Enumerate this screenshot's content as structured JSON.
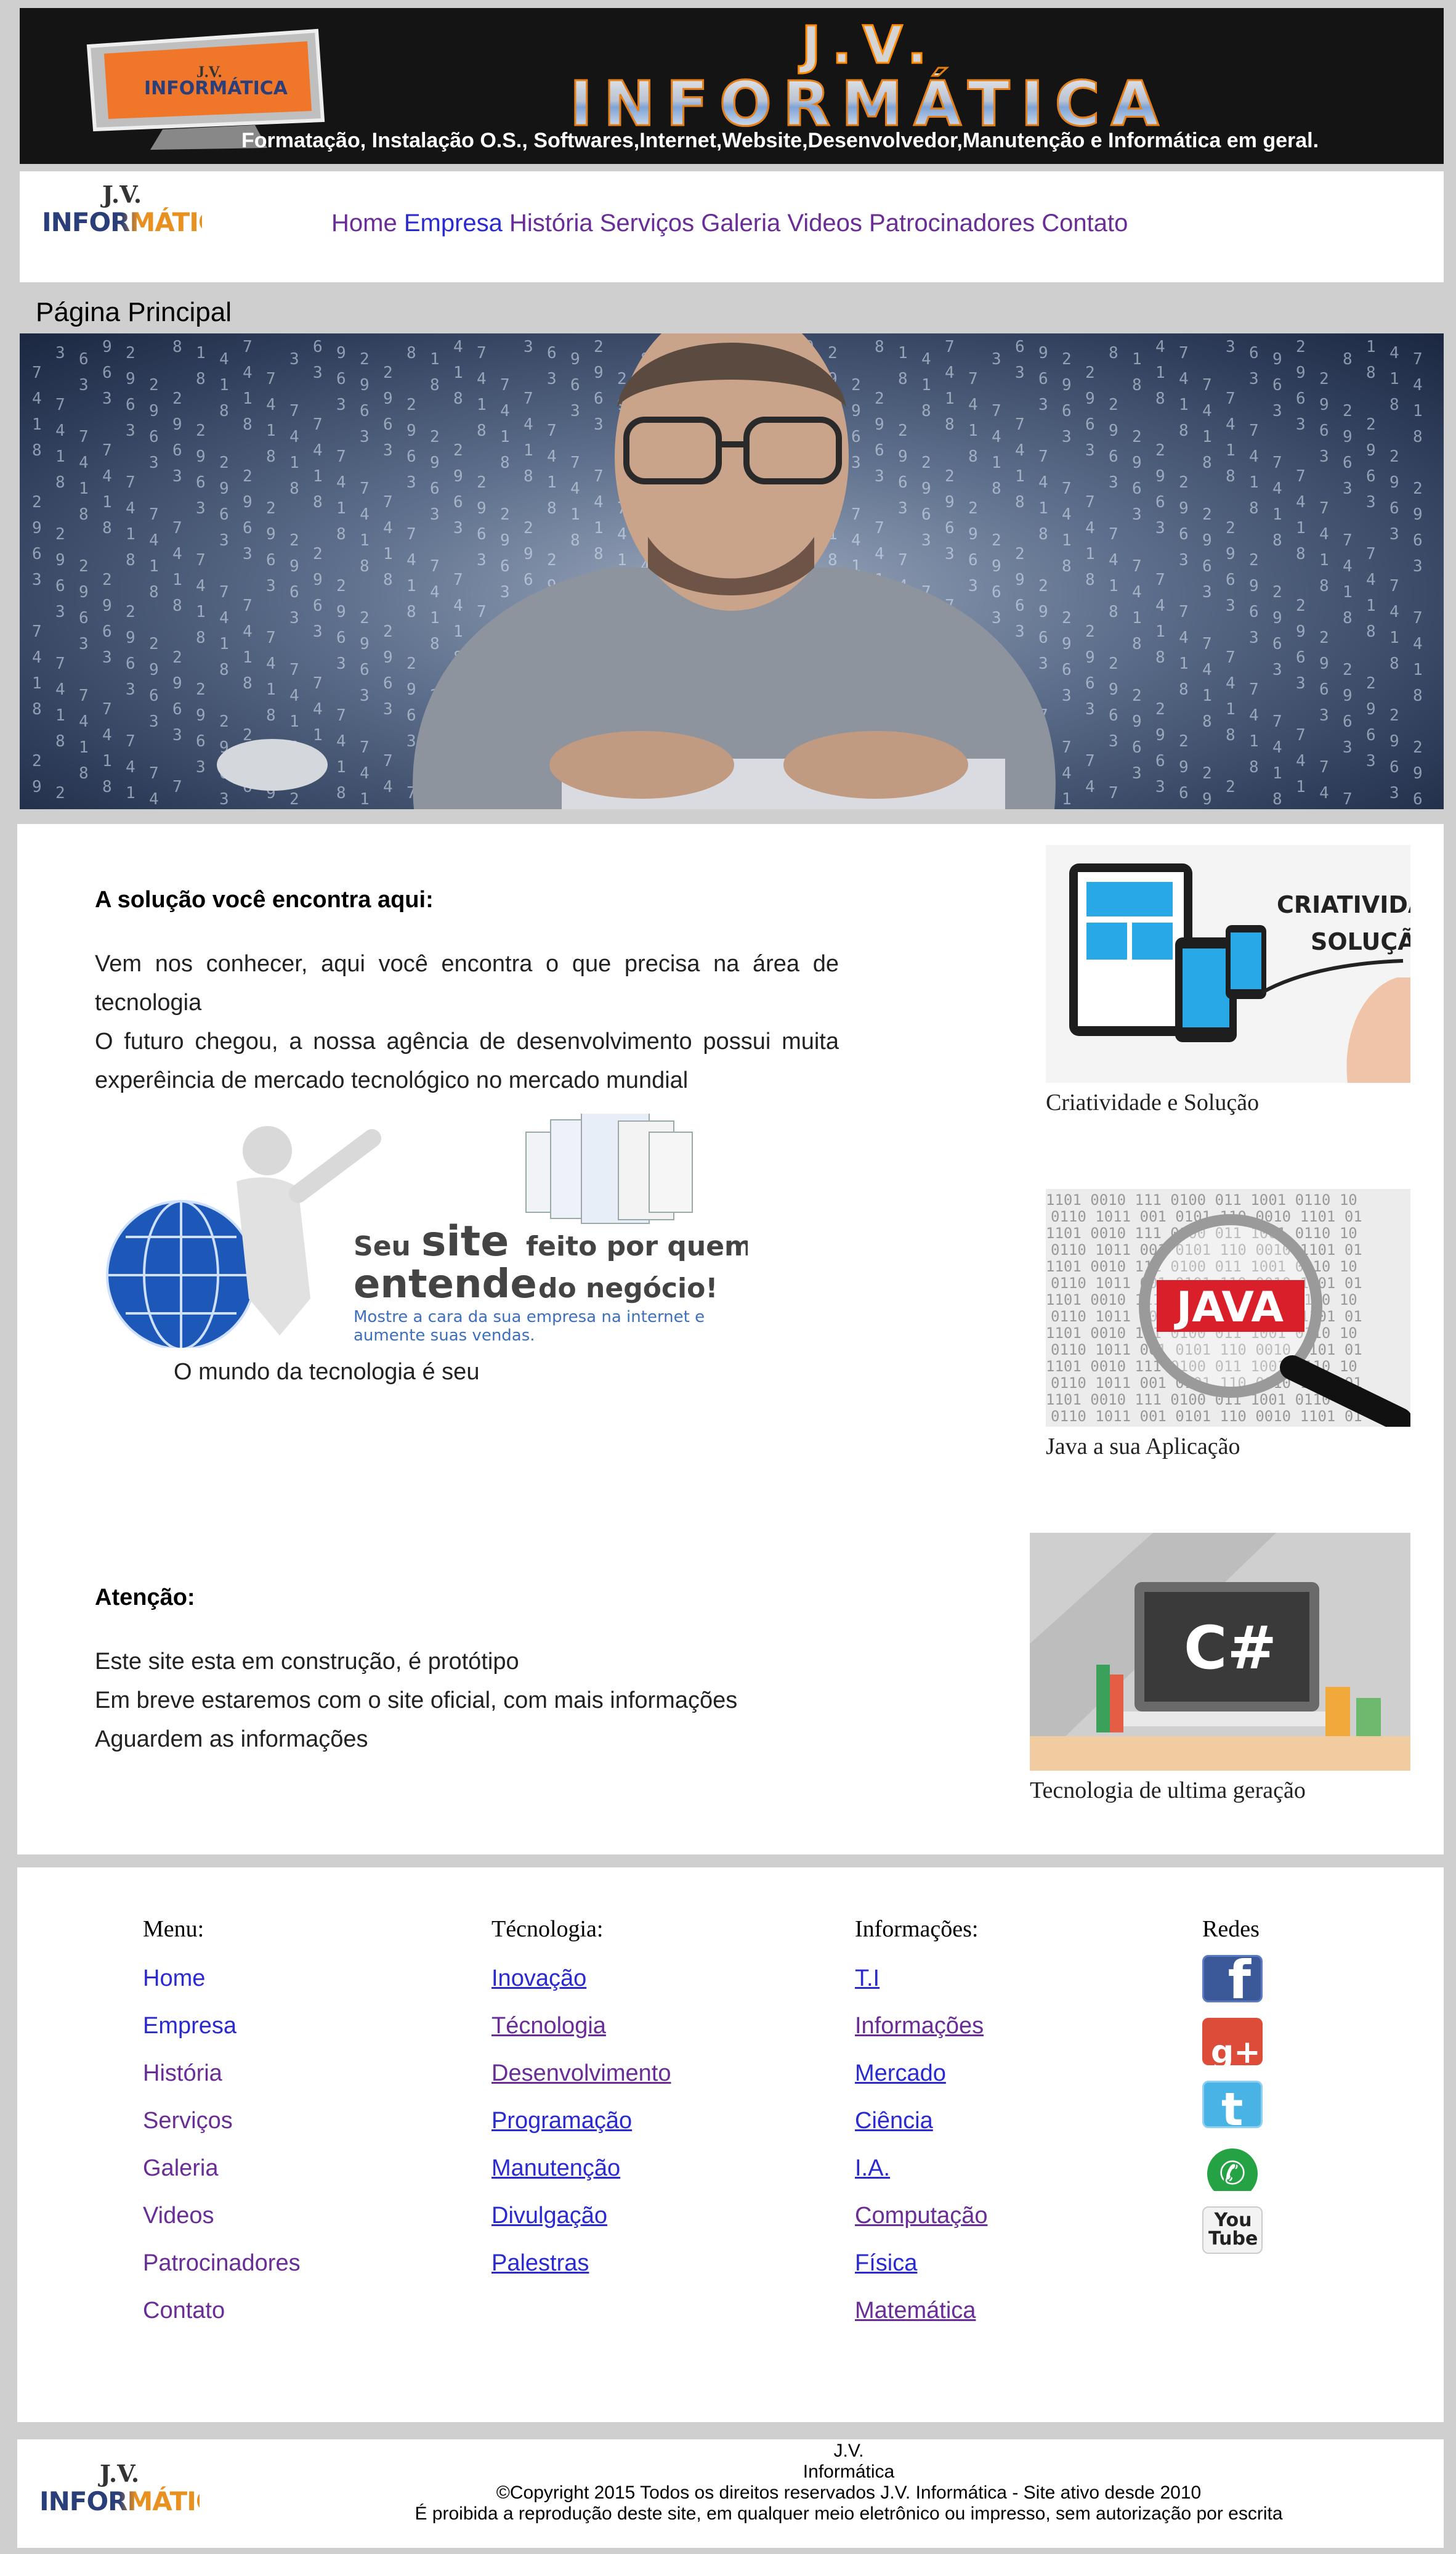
{
  "banner": {
    "brand_top": "J.V.",
    "brand_word": "INFORMÁTICA",
    "monitor_text_1": "J.V.",
    "monitor_text_2": "INFORMÁTICA",
    "tagline": "Formatação, Instalação O.S., Softwares,Internet,Website,Desenvolvedor,Manutenção e Informática em geral."
  },
  "logo": {
    "line1": "J.V.",
    "line2": "INFORMÁTICA"
  },
  "nav": {
    "items": [
      "Home",
      "Empresa",
      "História",
      "Serviços",
      "Galeria",
      "Videos",
      "Patrocinadores",
      "Contato"
    ],
    "current_color": "#2a2ad2",
    "visited_color": "#6a2c96"
  },
  "page_title": "Página Principal",
  "main": {
    "solution_heading": "A solução você encontra aqui:",
    "solution_lines": [
      "Vem nos conhecer, aqui você encontra o que precisa na área de tecnologia",
      "O futuro chegou, a nossa agência de desenvolvimento possui muita experêincia de mercado tecnológico no mercado mundial"
    ],
    "promo": {
      "line_a": "Seu",
      "line_b": "site",
      "line_c": "feito por quem",
      "line_d": "entende",
      "line_e": "do negócio!",
      "line_f": "Mostre a cara da sua empresa na internet e",
      "line_g": "aumente suas vendas."
    },
    "promo_caption": "O mundo da tecnologia é seu",
    "attention_heading": "Atenção:",
    "attention_lines": [
      "Este site esta em construção, é protótipo",
      "Em breve estaremos com o site oficial, com mais informações",
      "Aguardem as informações"
    ]
  },
  "side": [
    {
      "caption": "Criatividade e Solução",
      "img_text_1": "CRIATIVIDADE",
      "img_text_2": "SOLUÇÃO",
      "icon": "devices-icon"
    },
    {
      "caption": "Java a sua Aplicação",
      "img_text_1": "JAVA",
      "icon": "magnifier-icon"
    },
    {
      "caption": "Tecnologia de ultima geração",
      "img_text_1": "C#",
      "icon": "laptop-icon"
    }
  ],
  "footer": {
    "menu_title": "Menu:",
    "menu_items": [
      "Home",
      "Empresa",
      "História",
      "Serviços",
      "Galeria",
      "Videos",
      "Patrocinadores",
      "Contato"
    ],
    "tech_title": "Técnologia:",
    "tech_items": [
      "Inovação",
      "Técnologia",
      "Desenvolvimento",
      "Programação",
      "Manutenção",
      "Divulgação",
      "Palestras"
    ],
    "info_title": "Informações:",
    "info_items": [
      "T.I",
      "Informações",
      "Mercado",
      "Ciência",
      "I.A.",
      "Computação",
      "Física",
      "Matemática"
    ],
    "social_title": "Redes",
    "social": [
      {
        "icon": "facebook-icon",
        "glyph": "f",
        "color": "#3b5998"
      },
      {
        "icon": "google-plus-icon",
        "glyph": "g+",
        "color": "#dd4b39"
      },
      {
        "icon": "twitter-icon",
        "glyph": "t",
        "color": "#4ab3e6"
      },
      {
        "icon": "whatsapp-icon",
        "glyph": "✆",
        "color": "#25a244"
      },
      {
        "icon": "youtube-icon",
        "glyph": "You\nTube",
        "color": "#b31217"
      }
    ]
  },
  "copyright": {
    "line1": "J.V.",
    "line2": "Informática",
    "line3": "©Copyright 2015 Todos os direitos reservados J.V. Informática - Site ativo desde 2010",
    "line4": "É proibida a reprodução deste site, em qualquer meio eletrônico ou impresso, sem autorização por escrita"
  }
}
